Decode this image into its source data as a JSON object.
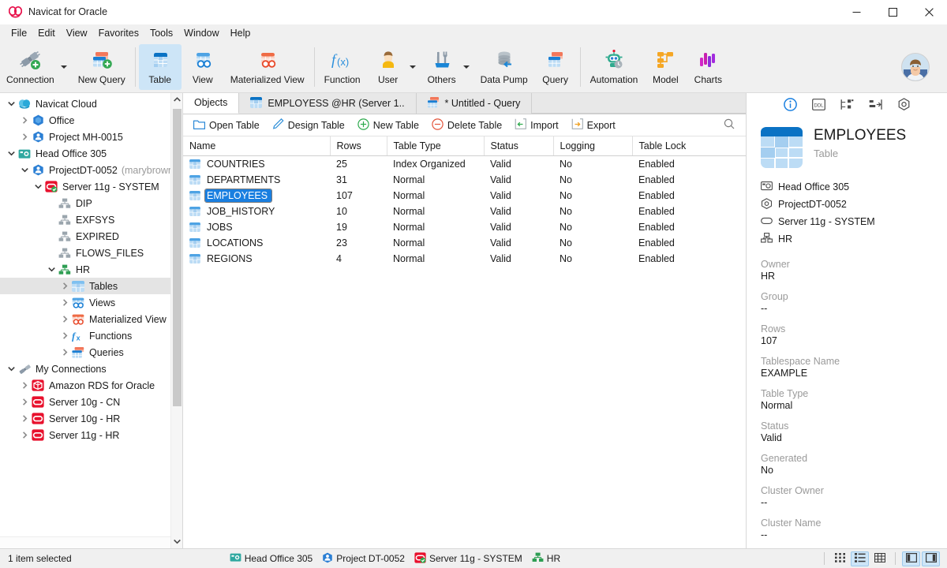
{
  "window": {
    "title": "Navicat for Oracle",
    "logo_icon": "navicat-logo-icon",
    "minimize": "—",
    "maximize": "□",
    "close": "✕"
  },
  "menubar": {
    "items": [
      "File",
      "Edit",
      "View",
      "Favorites",
      "Tools",
      "Window",
      "Help"
    ]
  },
  "ribbon": {
    "buttons": [
      {
        "label": "Connection",
        "icon": "connection-plug-icon",
        "dropdown": true,
        "active": false
      },
      {
        "label": "New Query",
        "icon": "new-query-icon",
        "dropdown": false,
        "active": false
      },
      {
        "label": "Table",
        "icon": "table-icon",
        "dropdown": false,
        "active": true
      },
      {
        "label": "View",
        "icon": "view-icon",
        "dropdown": false,
        "active": false
      },
      {
        "label": "Materialized View",
        "icon": "materialized-view-icon",
        "dropdown": false,
        "active": false
      },
      {
        "label": "Function",
        "icon": "function-fx-icon",
        "dropdown": false,
        "active": false
      },
      {
        "label": "User",
        "icon": "user-icon",
        "dropdown": true,
        "active": false
      },
      {
        "label": "Others",
        "icon": "others-tools-icon",
        "dropdown": true,
        "active": false
      },
      {
        "label": "Data Pump",
        "icon": "data-pump-icon",
        "dropdown": false,
        "active": false
      },
      {
        "label": "Query",
        "icon": "query-icon",
        "dropdown": false,
        "active": false
      },
      {
        "label": "Automation",
        "icon": "automation-robot-icon",
        "dropdown": false,
        "active": false
      },
      {
        "label": "Model",
        "icon": "model-icon",
        "dropdown": false,
        "active": false
      },
      {
        "label": "Charts",
        "icon": "charts-icon",
        "dropdown": false,
        "active": false
      }
    ],
    "avatar": "user-avatar"
  },
  "sidebar": {
    "items": [
      {
        "label": "Navicat Cloud",
        "icon": "navicat-cloud-icon",
        "indent": 0,
        "twisty": "down",
        "selected": false
      },
      {
        "label": "Office",
        "icon": "office-project-icon",
        "indent": 1,
        "twisty": "right",
        "selected": false
      },
      {
        "label": "Project MH-0015",
        "icon": "project-icon",
        "indent": 1,
        "twisty": "right",
        "selected": false
      },
      {
        "label": "Head Office 305",
        "icon": "head-office-icon",
        "indent": 0,
        "twisty": "down",
        "selected": false
      },
      {
        "label": "ProjectDT-0052",
        "sublabel": "(marybrown@",
        "icon": "project-icon",
        "indent": 1,
        "twisty": "down",
        "selected": false
      },
      {
        "label": "Server 11g - SYSTEM",
        "icon": "oracle-connection-connected-icon",
        "indent": 2,
        "twisty": "down",
        "selected": false
      },
      {
        "label": "DIP",
        "icon": "schema-icon",
        "indent": 3,
        "twisty": "none",
        "selected": false
      },
      {
        "label": "EXFSYS",
        "icon": "schema-icon",
        "indent": 3,
        "twisty": "none",
        "selected": false
      },
      {
        "label": "EXPIRED",
        "icon": "schema-icon",
        "indent": 3,
        "twisty": "none",
        "selected": false
      },
      {
        "label": "FLOWS_FILES",
        "icon": "schema-icon",
        "indent": 3,
        "twisty": "none",
        "selected": false
      },
      {
        "label": "HR",
        "icon": "schema-open-icon",
        "indent": 3,
        "twisty": "down",
        "selected": false
      },
      {
        "label": "Tables",
        "icon": "table-icon",
        "indent": 4,
        "twisty": "right",
        "selected": true
      },
      {
        "label": "Views",
        "icon": "view-icon",
        "indent": 4,
        "twisty": "right",
        "selected": false
      },
      {
        "label": "Materialized View",
        "icon": "materialized-view-icon",
        "indent": 4,
        "twisty": "right",
        "selected": false
      },
      {
        "label": "Functions",
        "icon": "function-fx-icon",
        "indent": 4,
        "twisty": "right",
        "selected": false
      },
      {
        "label": "Queries",
        "icon": "query-icon",
        "indent": 4,
        "twisty": "right",
        "selected": false
      },
      {
        "label": "My Connections",
        "icon": "my-connections-icon",
        "indent": 0,
        "twisty": "down",
        "selected": false
      },
      {
        "label": "Amazon RDS for Oracle",
        "icon": "amazon-rds-icon",
        "indent": 1,
        "twisty": "right",
        "selected": false
      },
      {
        "label": "Server 10g - CN",
        "icon": "oracle-connection-icon",
        "indent": 1,
        "twisty": "right",
        "selected": false
      },
      {
        "label": "Server 10g - HR",
        "icon": "oracle-connection-icon",
        "indent": 1,
        "twisty": "right",
        "selected": false
      },
      {
        "label": "Server 11g - HR",
        "icon": "oracle-connection-icon",
        "indent": 1,
        "twisty": "right",
        "selected": false
      }
    ]
  },
  "tabs": [
    {
      "label": "Objects",
      "icon": "",
      "active": true
    },
    {
      "label": "EMPLOYESS @HR (Server 1..",
      "icon": "table-icon",
      "active": false
    },
    {
      "label": "* Untitled - Query",
      "icon": "query-icon",
      "active": false
    }
  ],
  "objectbar": {
    "buttons": [
      {
        "label": "Open Table",
        "icon": "open-folder-icon"
      },
      {
        "label": "Design Table",
        "icon": "pencil-icon"
      },
      {
        "label": "New Table",
        "icon": "plus-circle-icon"
      },
      {
        "label": "Delete Table",
        "icon": "minus-circle-icon"
      },
      {
        "label": "Import",
        "icon": "import-arrow-icon"
      },
      {
        "label": "Export",
        "icon": "export-arrow-icon"
      }
    ],
    "search_icon": "search-icon"
  },
  "table": {
    "columns": [
      "Name",
      "Rows",
      "Table Type",
      "Status",
      "Logging",
      "Table Lock"
    ],
    "rows": [
      {
        "name": "COUNTRIES",
        "rows": "25",
        "type": "Index Organized",
        "status": "Valid",
        "logging": "No",
        "lock": "Enabled",
        "selected": false
      },
      {
        "name": "DEPARTMENTS",
        "rows": "31",
        "type": "Normal",
        "status": "Valid",
        "logging": "No",
        "lock": "Enabled",
        "selected": false
      },
      {
        "name": "EMPLOYEES",
        "rows": "107",
        "type": "Normal",
        "status": "Valid",
        "logging": "No",
        "lock": "Enabled",
        "selected": true
      },
      {
        "name": "JOB_HISTORY",
        "rows": "10",
        "type": "Normal",
        "status": "Valid",
        "logging": "No",
        "lock": "Enabled",
        "selected": false
      },
      {
        "name": "JOBS",
        "rows": "19",
        "type": "Normal",
        "status": "Valid",
        "logging": "No",
        "lock": "Enabled",
        "selected": false
      },
      {
        "name": "LOCATIONS",
        "rows": "23",
        "type": "Normal",
        "status": "Valid",
        "logging": "No",
        "lock": "Enabled",
        "selected": false
      },
      {
        "name": "REGIONS",
        "rows": "4",
        "type": "Normal",
        "status": "Valid",
        "logging": "No",
        "lock": "Enabled",
        "selected": false
      }
    ]
  },
  "info": {
    "tabs": [
      {
        "name": "info-tab",
        "icon": "info-circle-icon",
        "active": true
      },
      {
        "name": "ddl-tab",
        "icon": "ddl-icon",
        "active": false
      },
      {
        "name": "er-diagram-tab",
        "icon": "er-diagram-icon",
        "active": false
      },
      {
        "name": "preview-tab",
        "icon": "preview-icon",
        "active": false
      },
      {
        "name": "settings-tab",
        "icon": "hexagon-gear-icon",
        "active": false
      }
    ],
    "title": "EMPLOYEES",
    "subtitle": "Table",
    "breadcrumb": [
      {
        "label": "Head Office 305",
        "icon": "head-office-icon"
      },
      {
        "label": "ProjectDT-0052",
        "icon": "hexagon-project-icon"
      },
      {
        "label": "Server 11g - SYSTEM",
        "icon": "oracle-connection-outline-icon"
      },
      {
        "label": "HR",
        "icon": "schema-outline-icon"
      }
    ],
    "properties": [
      {
        "label": "Owner",
        "value": "HR"
      },
      {
        "label": "Group",
        "value": "--"
      },
      {
        "label": "Rows",
        "value": "107"
      },
      {
        "label": "Tablespace Name",
        "value": "EXAMPLE"
      },
      {
        "label": "Table Type",
        "value": "Normal"
      },
      {
        "label": "Status",
        "value": "Valid"
      },
      {
        "label": "Generated",
        "value": "No"
      },
      {
        "label": "Cluster Owner",
        "value": "--"
      },
      {
        "label": "Cluster Name",
        "value": "--"
      }
    ]
  },
  "statusbar": {
    "selection_text": "1 item selected",
    "context": [
      {
        "label": "Head Office 305",
        "icon": "head-office-icon"
      },
      {
        "label": "Project DT-0052",
        "icon": "project-icon"
      },
      {
        "label": "Server 11g - SYSTEM",
        "icon": "oracle-connection-connected-icon"
      },
      {
        "label": "HR",
        "icon": "schema-open-icon"
      }
    ],
    "view_buttons": [
      {
        "name": "grid-view-button",
        "icon": "grid-view-icon",
        "active": false
      },
      {
        "name": "list-view-button",
        "icon": "list-view-icon",
        "active": true
      },
      {
        "name": "detail-view-button",
        "icon": "detail-view-icon",
        "active": false
      }
    ],
    "panel_buttons": [
      {
        "name": "toggle-left-panel-button",
        "icon": "left-panel-icon",
        "active": true
      },
      {
        "name": "toggle-right-panel-button",
        "icon": "right-panel-icon",
        "active": true
      }
    ]
  },
  "colors": {
    "accent": "#1a7fe0",
    "ribbon_active": "#cde5f7",
    "oracle_red": "#e8112d",
    "schema_green": "#35a853"
  }
}
